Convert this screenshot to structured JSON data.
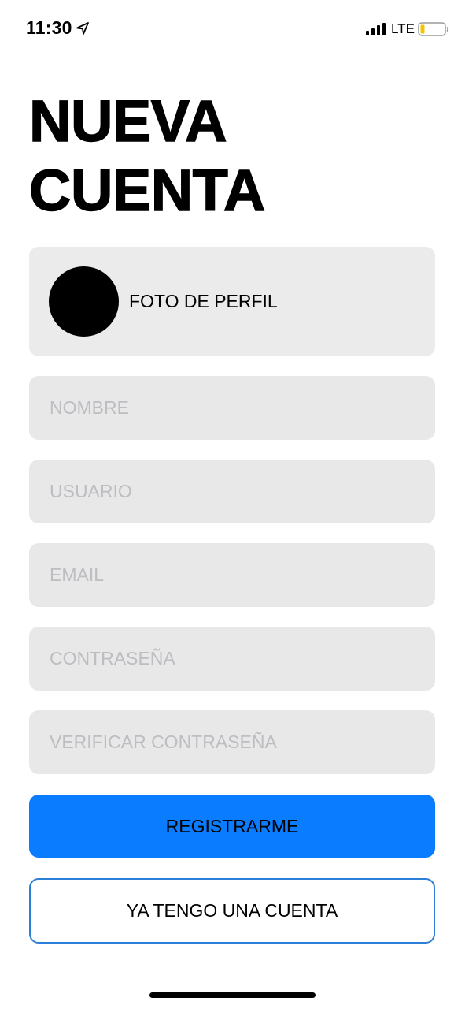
{
  "status_bar": {
    "time": "11:30",
    "network": "LTE",
    "icons": [
      "location-arrow-icon",
      "cellular-signal-icon",
      "battery-low-icon"
    ],
    "battery_color": "#f5c400"
  },
  "title": {
    "line1": "NUEVA",
    "line2": "CUENTA"
  },
  "profile": {
    "label": "FOTO DE PERFIL"
  },
  "form": {
    "name_placeholder": "NOMBRE",
    "user_placeholder": "USUARIO",
    "email_placeholder": "EMAIL",
    "password_placeholder": "CONTRASEÑA",
    "verify_placeholder": "VERIFICAR CONTRASEÑA"
  },
  "actions": {
    "register_label": "REGISTRARME",
    "have_account_label": "YA TENGO UNA CUENTA"
  },
  "colors": {
    "primary": "#0a7cff",
    "field_bg": "#e8e8e8",
    "placeholder": "#bdbdc2",
    "outline_button_border": "#2b7fd6"
  }
}
